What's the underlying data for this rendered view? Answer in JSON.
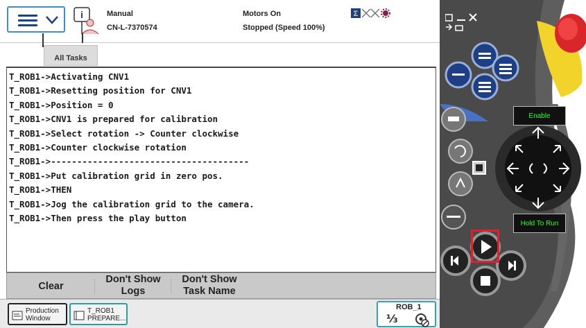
{
  "topbar": {
    "mode": "Manual",
    "controller_name": "CN-L-7370574",
    "motors": "Motors On",
    "state": "Stopped (Speed 100%)",
    "tab_all_tasks": "All Tasks"
  },
  "log": {
    "lines": [
      "T_ROB1->Activating CNV1",
      "T_ROB1->Resetting position for CNV1",
      "T_ROB1->Position = 0",
      "T_ROB1->CNV1 is prepared for calibration",
      "T_ROB1->Select rotation -> Counter clockwise",
      "T_ROB1->Counter clockwise rotation",
      "T_ROB1->--------------------------------------",
      "T_ROB1->Put calibration grid in zero pos.",
      "T_ROB1->THEN",
      "T_ROB1->Jog the calibration grid to the camera.",
      "T_ROB1->Then press the play button"
    ]
  },
  "buttons": {
    "clear": "Clear",
    "dont_show_logs_1": "Don't Show",
    "dont_show_logs_2": "Logs",
    "dont_show_task_1": "Don't Show",
    "dont_show_task_2": "Task Name"
  },
  "taskbar": {
    "production_1": "Production",
    "production_2": "Window",
    "task_1": "T_ROB1",
    "task_2": "PREPARE...",
    "robot_name": "ROB_1",
    "fraction": "⅓"
  },
  "pendant": {
    "enable_label": "Enable",
    "hold_label": "Hold To Run"
  },
  "colors": {
    "accent_blue": "#3a8fd0",
    "pendant_gray": "#5a5a5a",
    "pendant_yellow": "#f2d32a",
    "estop_red": "#d8262a",
    "highlight_red": "#e0202a",
    "hw_button_blue": "#1e3f86"
  }
}
